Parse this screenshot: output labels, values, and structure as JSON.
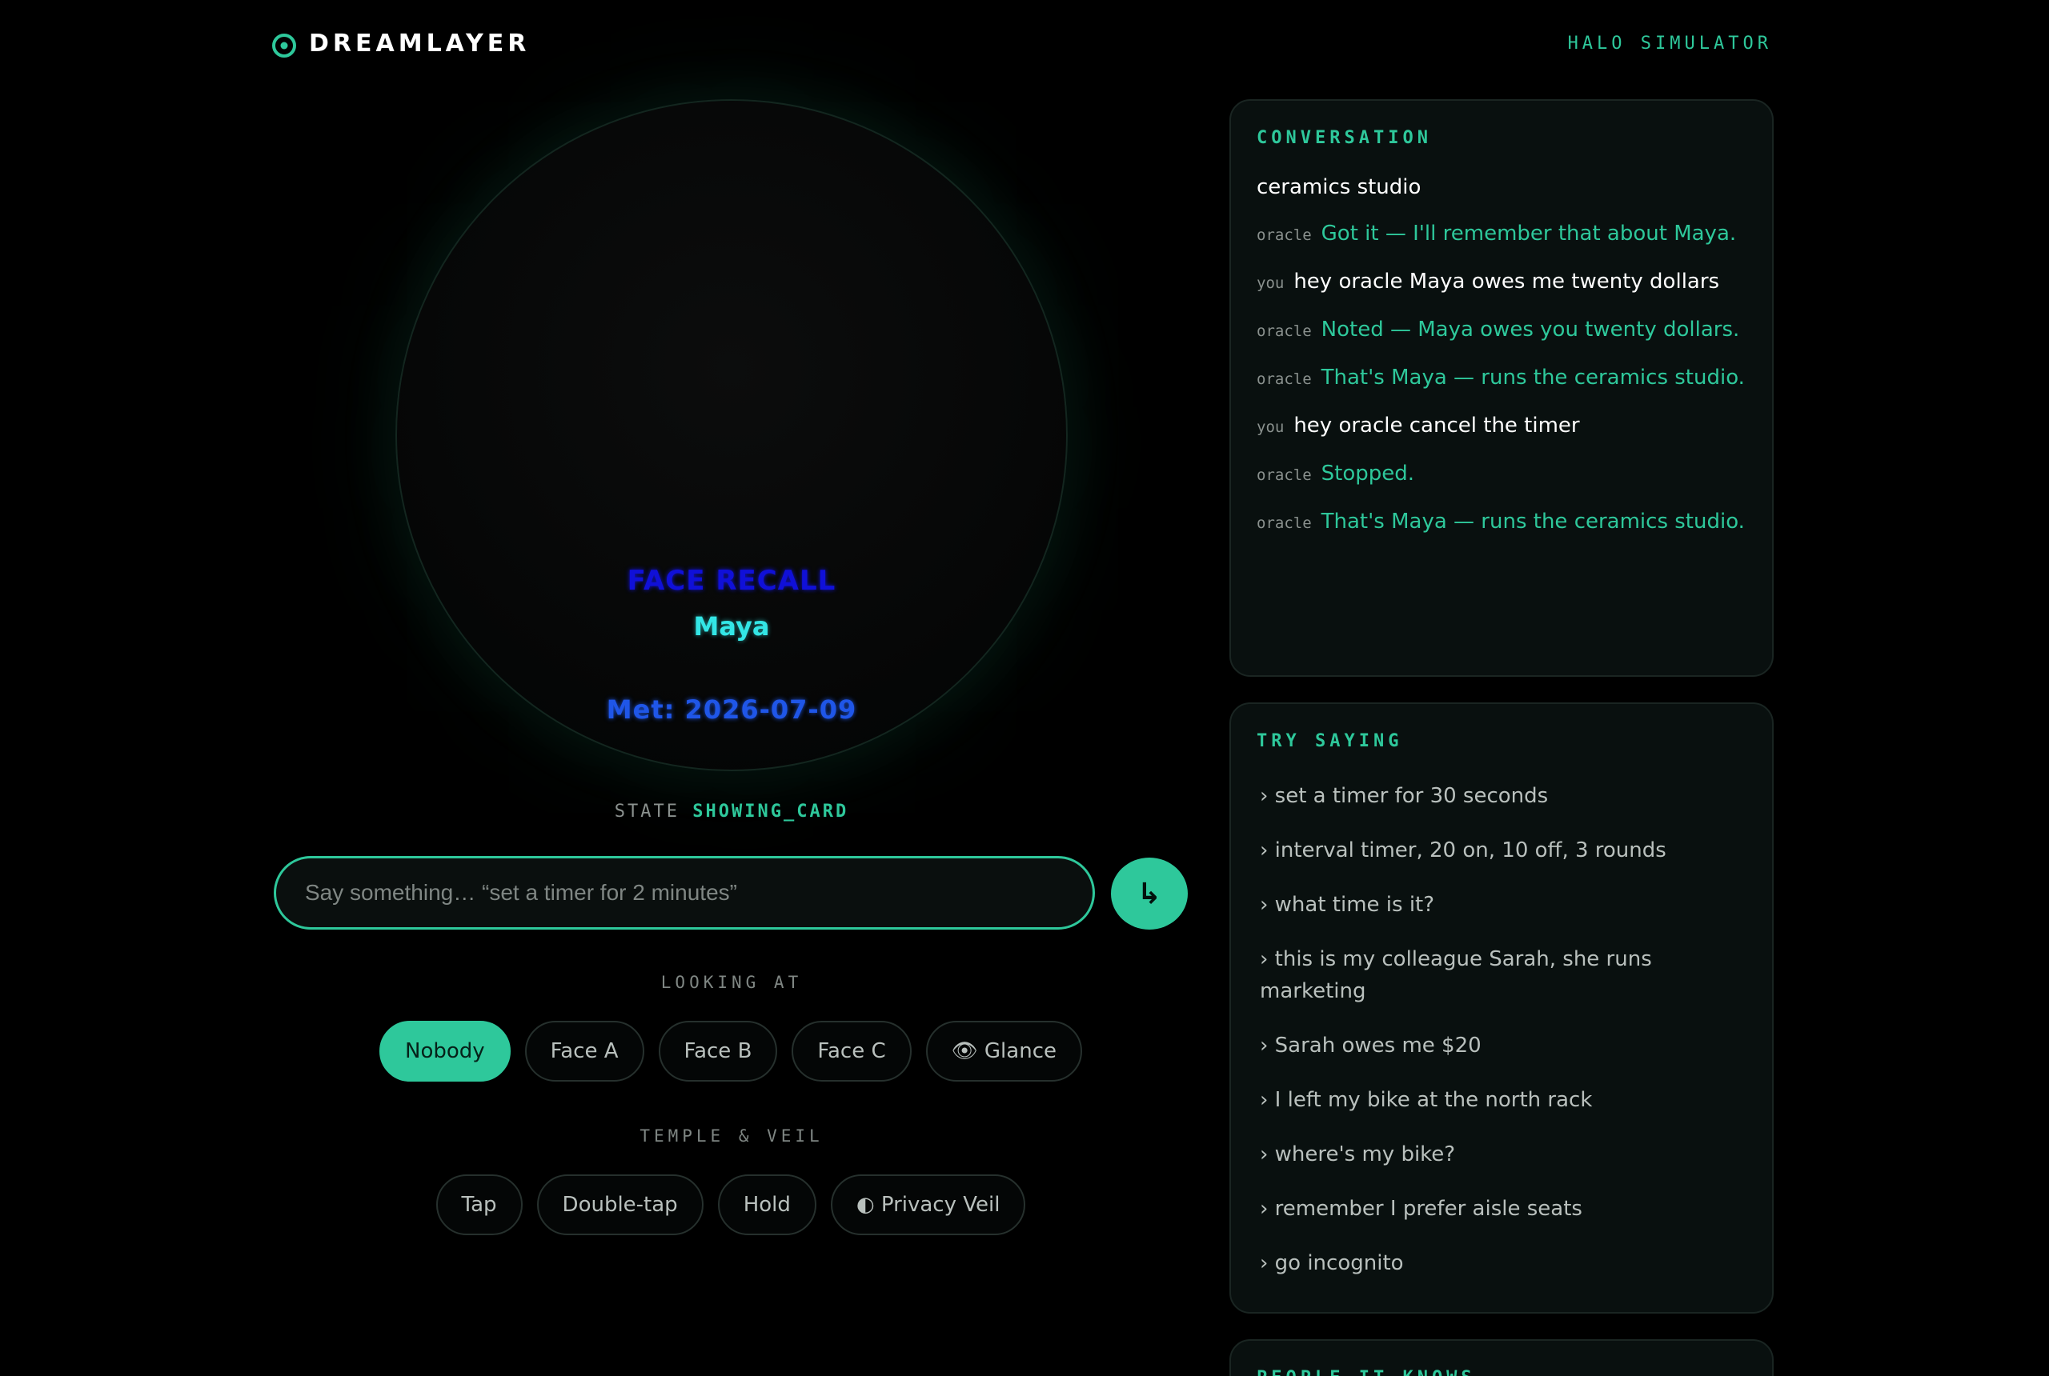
{
  "header": {
    "brand": "DREAMLAYER",
    "brand_icon": "target-icon",
    "simulator_label": "HALO SIMULATOR"
  },
  "halo": {
    "card_title": "FACE RECALL",
    "card_name": "Maya",
    "card_met": "Met: 2026-07-09"
  },
  "state": {
    "label": "STATE",
    "value": "SHOWING_CARD"
  },
  "input": {
    "placeholder": "Say something… “set a timer for 2 minutes”",
    "send_icon": "↳"
  },
  "looking_at": {
    "label": "LOOKING AT",
    "options": [
      "Nobody",
      "Face A",
      "Face B",
      "Face C",
      "👁 Glance"
    ],
    "selected": "Nobody"
  },
  "temple_veil": {
    "label": "TEMPLE & VEIL",
    "options": [
      "Tap",
      "Double-tap",
      "Hold",
      "◐ Privacy Veil"
    ]
  },
  "conversation": {
    "title": "CONVERSATION",
    "messages": [
      {
        "who": "",
        "text": "ceramics studio"
      },
      {
        "who": "oracle",
        "text": "Got it — I'll remember that about Maya."
      },
      {
        "who": "you",
        "text": "hey oracle Maya owes me twenty dollars"
      },
      {
        "who": "oracle",
        "text": "Noted — Maya owes you twenty dollars."
      },
      {
        "who": "oracle",
        "text": "That's Maya — runs the ceramics studio."
      },
      {
        "who": "you",
        "text": "hey oracle cancel the timer"
      },
      {
        "who": "oracle",
        "text": "Stopped."
      },
      {
        "who": "oracle",
        "text": "That's Maya — runs the ceramics studio."
      }
    ]
  },
  "try_saying": {
    "title": "TRY SAYING",
    "items": [
      "› set a timer for 30 seconds",
      "› interval timer, 20 on, 10 off, 3 rounds",
      "› what time is it?",
      "› this is my colleague Sarah, she runs marketing",
      "› Sarah owes me $20",
      "› I left my bike at the north rack",
      "› where's my bike?",
      "› remember I prefer aisle seats",
      "› go incognito"
    ]
  },
  "people": {
    "title": "PEOPLE IT KNOWS"
  },
  "colors": {
    "accent": "#2ec89b",
    "background": "#000000",
    "panel": "#09100f"
  }
}
